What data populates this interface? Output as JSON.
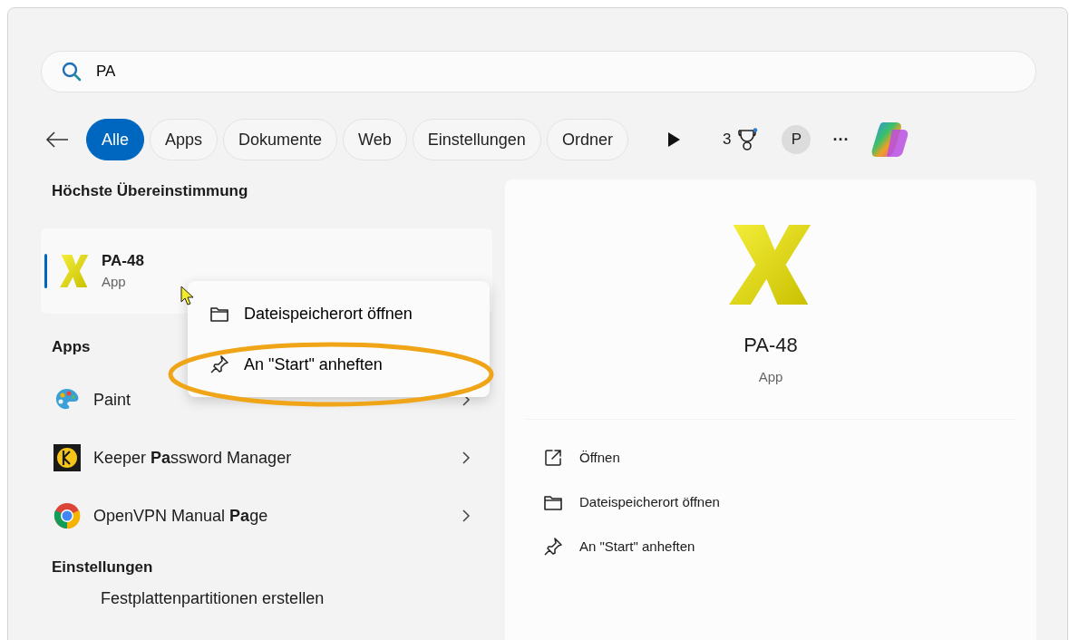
{
  "search": {
    "value": "PA"
  },
  "filters": [
    {
      "label": "Alle",
      "selected": true
    },
    {
      "label": "Apps",
      "selected": false
    },
    {
      "label": "Dokumente",
      "selected": false
    },
    {
      "label": "Web",
      "selected": false
    },
    {
      "label": "Einstellungen",
      "selected": false
    },
    {
      "label": "Ordner",
      "selected": false
    }
  ],
  "toolbar": {
    "points": "3",
    "avatar": "P",
    "more": "···"
  },
  "best_match": {
    "heading": "Höchste Übereinstimmung",
    "name": "PA-48",
    "type": "App",
    "selected": true
  },
  "context_menu": {
    "items": [
      {
        "label": "Dateispeicherort öffnen",
        "highlighted": false
      },
      {
        "label": "An \"Start\" anheften",
        "highlighted": true
      }
    ]
  },
  "apps": {
    "heading": "Apps",
    "items": [
      {
        "name": "Paint"
      },
      {
        "name": "Keeper **Pa**ssword Manager"
      },
      {
        "name": "OpenVPN Manual **Pa**ge"
      }
    ]
  },
  "settings": {
    "heading": "Einstellungen",
    "items": [
      {
        "name": "Festplattenpartitionen erstellen"
      }
    ]
  },
  "detail": {
    "name": "PA-48",
    "type": "App",
    "actions": [
      {
        "label": "Öffnen"
      },
      {
        "label": "Dateispeicherort öffnen"
      },
      {
        "label": "An \"Start\" anheften"
      }
    ]
  }
}
